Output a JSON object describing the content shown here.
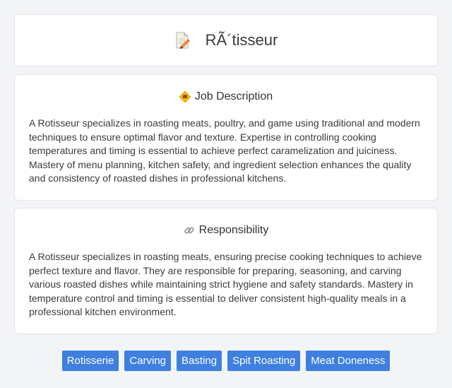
{
  "header": {
    "title": "RÃ´tisseur",
    "icon": "document-pencil-icon"
  },
  "job_description": {
    "heading": "Job Description",
    "icon": "badge-icon",
    "text": "A Rotisseur specializes in roasting meats, poultry, and game using traditional and modern techniques to ensure optimal flavor and texture. Expertise in controlling cooking temperatures and timing is essential to achieve perfect caramelization and juiciness. Mastery of menu planning, kitchen safety, and ingredient selection enhances the quality and consistency of roasted dishes in professional kitchens."
  },
  "responsibility": {
    "heading": "Responsibility",
    "icon": "link-icon",
    "text": "A Rotisseur specializes in roasting meats, ensuring precise cooking techniques to achieve perfect texture and flavor. They are responsible for preparing, seasoning, and carving various roasted dishes while maintaining strict hygiene and safety standards. Mastery in temperature control and timing is essential to deliver consistent high-quality meals in a professional kitchen environment."
  },
  "tags": [
    "Rotisserie",
    "Carving",
    "Basting",
    "Spit Roasting",
    "Meat Doneness"
  ],
  "colors": {
    "tag_bg": "#3f7fe0",
    "background": "#f3f4f6"
  }
}
